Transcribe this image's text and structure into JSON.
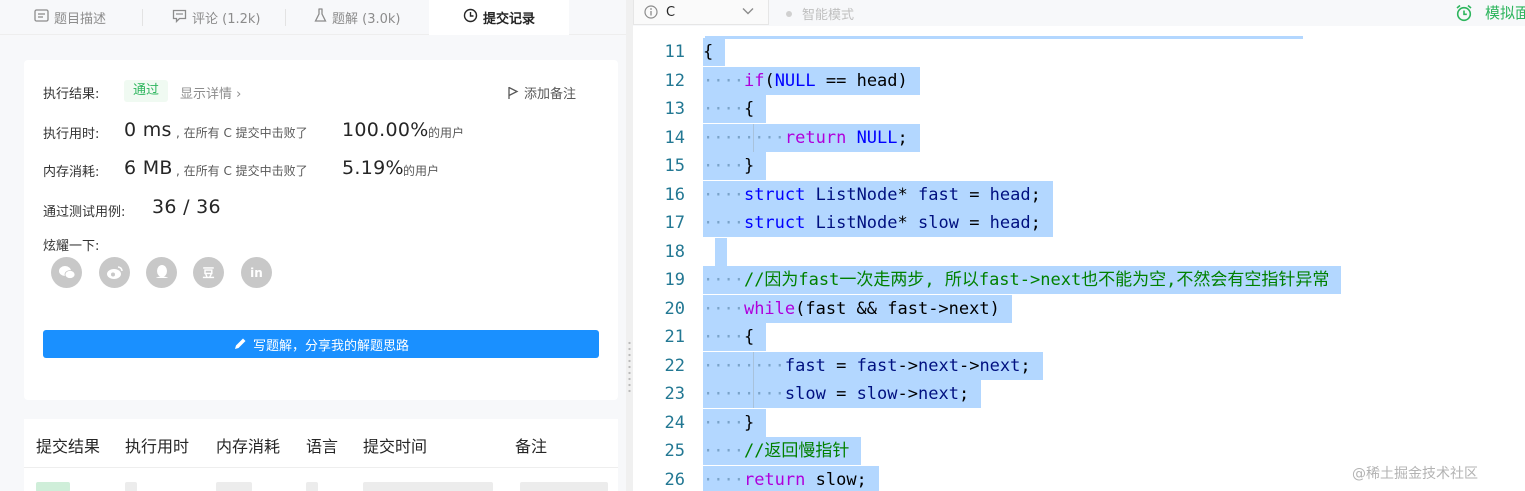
{
  "tabs": [
    {
      "label": "题目描述",
      "icon": "description-icon",
      "active": false
    },
    {
      "label": "评论 (1.2k)",
      "icon": "comment-icon",
      "active": false
    },
    {
      "label": "题解 (3.0k)",
      "icon": "flask-icon",
      "active": false
    },
    {
      "label": "提交记录",
      "icon": "clock-icon",
      "active": true
    }
  ],
  "result": {
    "status_label": "执行结果:",
    "status_value": "通过",
    "detail_link": "显示详情 ›",
    "add_note": "添加备注",
    "runtime_label": "执行用时:",
    "runtime_value": "0 ms",
    "runtime_text": ", 在所有 C 提交中击败了",
    "runtime_percent": "100.00%",
    "runtime_suffix": "的用户",
    "memory_label": "内存消耗:",
    "memory_value": "6 MB",
    "memory_text": ", 在所有 C 提交中击败了",
    "memory_percent": "5.19%",
    "memory_suffix": "的用户",
    "tests_label": "通过测试用例:",
    "tests_value": "36 / 36",
    "share_label": "炫耀一下:",
    "share_icons": [
      "wechat-icon",
      "weibo-icon",
      "qq-icon",
      "douban-icon",
      "linkedin-icon"
    ],
    "share_glyphs": [
      "",
      "",
      "",
      "豆",
      "in"
    ],
    "write_button": "写题解，分享我的解题思路"
  },
  "table": {
    "headers": [
      "提交结果",
      "执行用时",
      "内存消耗",
      "语言",
      "提交时间",
      "备注"
    ]
  },
  "editor": {
    "language": "C",
    "smart_mode": "智能模式",
    "mock_label": "模拟面试",
    "lines": [
      {
        "n": "11",
        "text": "{"
      },
      {
        "n": "12",
        "text": "    if(NULL == head)"
      },
      {
        "n": "13",
        "text": "    {"
      },
      {
        "n": "14",
        "text": "        return NULL;"
      },
      {
        "n": "15",
        "text": "    }"
      },
      {
        "n": "16",
        "text": "    struct ListNode* fast = head;"
      },
      {
        "n": "17",
        "text": "    struct ListNode* slow = head;"
      },
      {
        "n": "18",
        "text": ""
      },
      {
        "n": "19",
        "text": "    //因为fast一次走两步, 所以fast->next也不能为空,不然会有空指针异常"
      },
      {
        "n": "20",
        "text": "    while(fast && fast->next)"
      },
      {
        "n": "21",
        "text": "    {"
      },
      {
        "n": "22",
        "text": "        fast = fast->next->next;"
      },
      {
        "n": "23",
        "text": "        slow = slow->next;"
      },
      {
        "n": "24",
        "text": "    }"
      },
      {
        "n": "25",
        "text": "    //返回慢指针"
      },
      {
        "n": "26",
        "text": "    return slow;"
      }
    ]
  },
  "watermark": "@稀土掘金技术社区"
}
